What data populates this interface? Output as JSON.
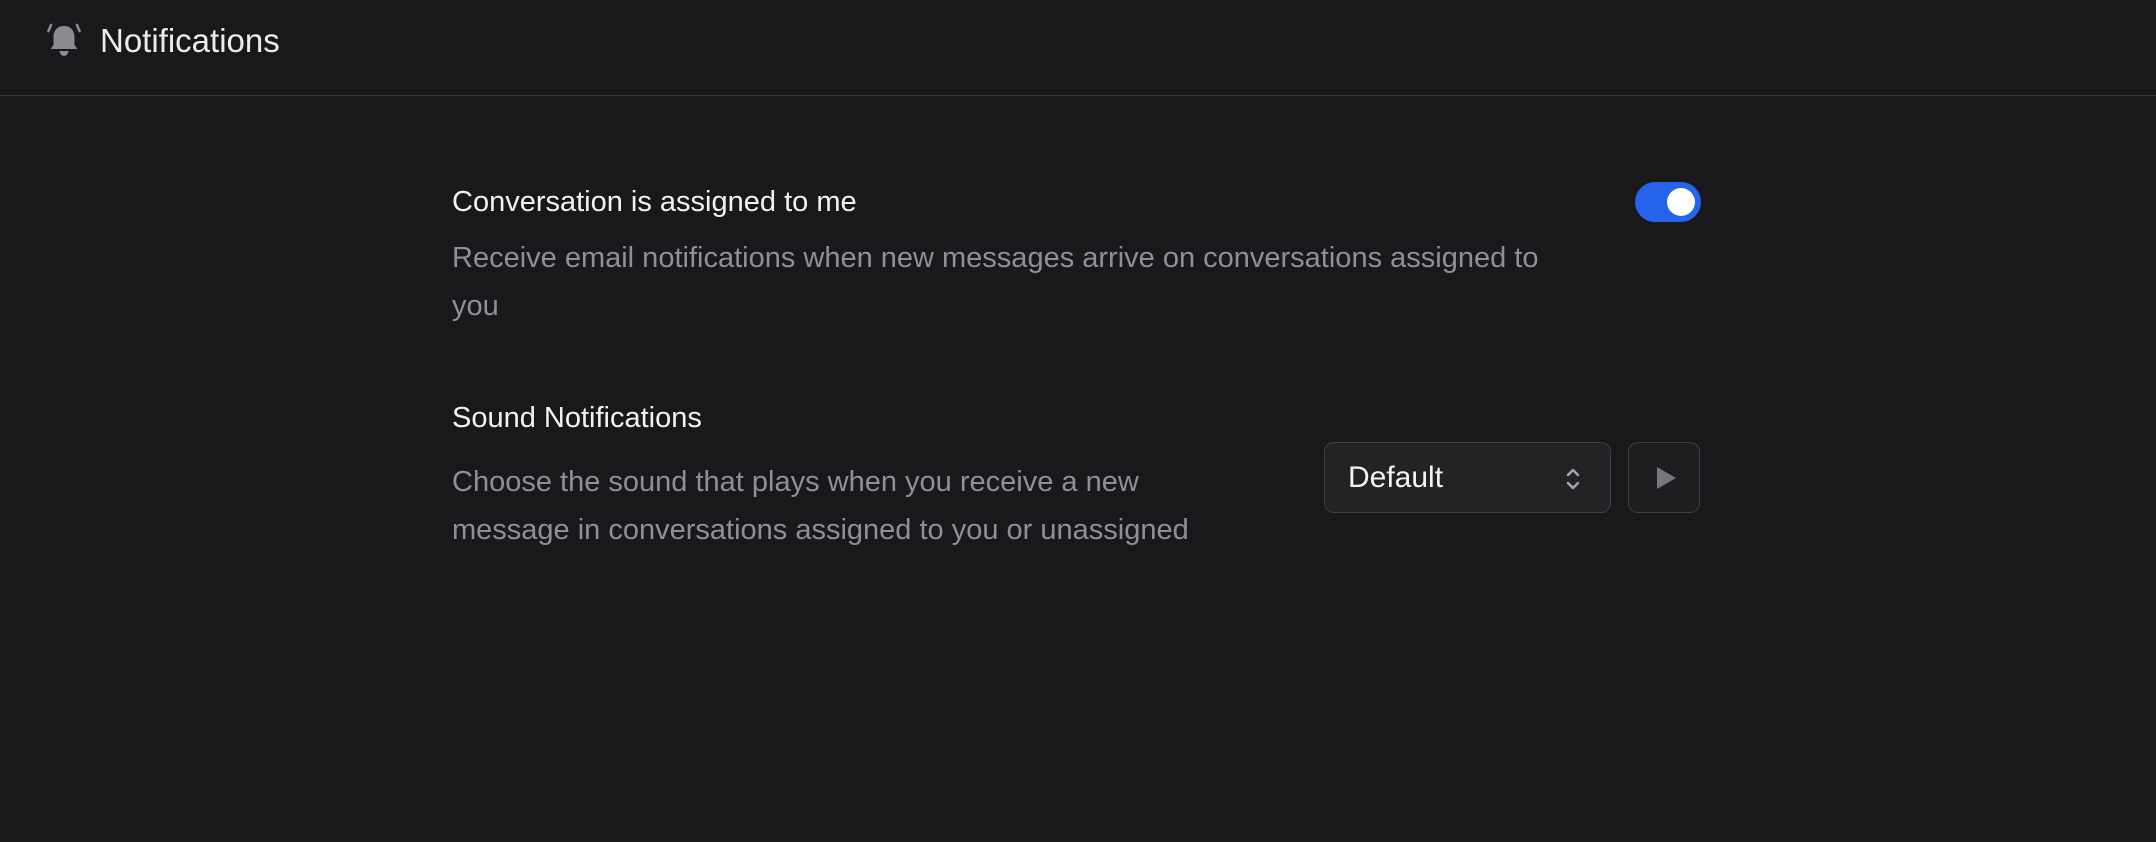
{
  "header": {
    "icon": "bell-icon",
    "title": "Notifications"
  },
  "settings": {
    "assigned": {
      "title": "Conversation is assigned to me",
      "description_line1": "Receive email notifications when new messages arrive on conversations assigned to",
      "description_line2": "you",
      "enabled": true
    },
    "sound": {
      "title": "Sound Notifications",
      "description_line1": "Choose the sound that plays when you receive a new",
      "description_line2": "message in conversations assigned to you or unassigned",
      "selected": "Default"
    }
  },
  "colors": {
    "background": "#19191b",
    "accent": "#2563eb",
    "muted_text": "#8f8f96"
  },
  "icons": {
    "select_chevron": "chevron-up-down-icon",
    "play": "play-icon"
  }
}
